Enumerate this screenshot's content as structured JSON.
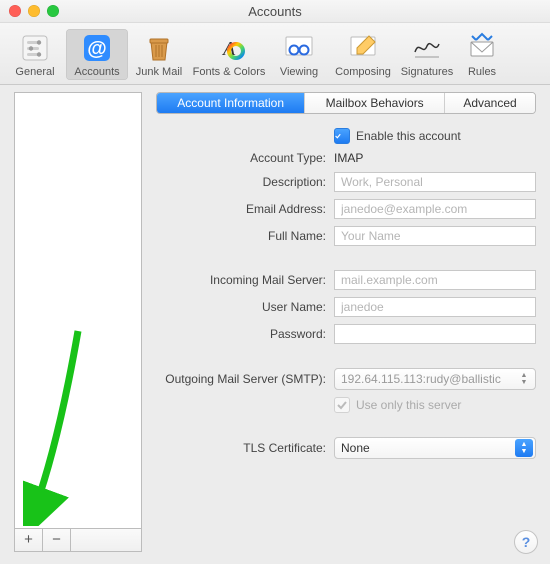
{
  "window": {
    "title": "Accounts"
  },
  "toolbar": {
    "items": [
      {
        "label": "General"
      },
      {
        "label": "Accounts"
      },
      {
        "label": "Junk Mail"
      },
      {
        "label": "Fonts & Colors"
      },
      {
        "label": "Viewing"
      },
      {
        "label": "Composing"
      },
      {
        "label": "Signatures"
      },
      {
        "label": "Rules"
      }
    ],
    "selected_index": 1
  },
  "sidebar": {
    "add_label": "+",
    "remove_label": "−"
  },
  "tabs": {
    "items": [
      "Account Information",
      "Mailbox Behaviors",
      "Advanced"
    ],
    "active_index": 0
  },
  "form": {
    "enable": {
      "label": "Enable this account",
      "checked": true
    },
    "account_type": {
      "label": "Account Type:",
      "value": "IMAP"
    },
    "description": {
      "label": "Description:",
      "placeholder": "Work, Personal",
      "value": ""
    },
    "email": {
      "label": "Email Address:",
      "placeholder": "janedoe@example.com",
      "value": ""
    },
    "full_name": {
      "label": "Full Name:",
      "placeholder": "Your Name",
      "value": ""
    },
    "incoming": {
      "label": "Incoming Mail Server:",
      "placeholder": "mail.example.com",
      "value": ""
    },
    "user_name": {
      "label": "User Name:",
      "placeholder": "janedoe",
      "value": ""
    },
    "password": {
      "label": "Password:",
      "value": ""
    },
    "smtp": {
      "label": "Outgoing Mail Server (SMTP):",
      "value": "192.64.115.113:rudy@ballistic"
    },
    "use_only": {
      "label": "Use only this server",
      "checked": true
    },
    "tls": {
      "label": "TLS Certificate:",
      "value": "None"
    }
  },
  "help": {
    "label": "?"
  }
}
